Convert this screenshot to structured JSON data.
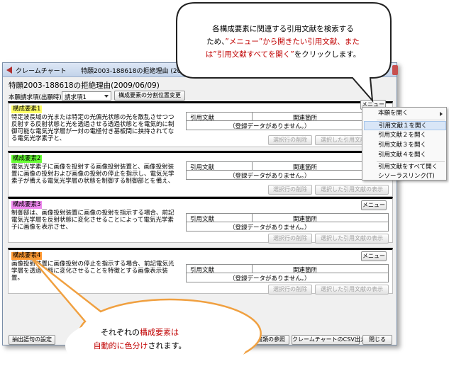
{
  "window": {
    "title_app": "クレームチャート",
    "title_doc": "特願2003-188618の拒絶理由 (2009/06/09)"
  },
  "heading": "特願2003-188618の拒絶理由(2009/06/09)",
  "claim_selector": {
    "label": "本願請求項(出願時):",
    "value": "請求項1",
    "split_button": "構成要素の分割位置変更"
  },
  "table_headers": {
    "citation": "引用文献",
    "location": "関連箇所"
  },
  "empty_message": "（登録データがありません。）",
  "panel_buttons": {
    "menu": "メニュー",
    "delete_selected": "選択行の削除",
    "show_selected": "選択した引用文献の表示"
  },
  "elements": [
    {
      "label": "構成要素1",
      "color": "#ffff66",
      "text": "特定波長域の光または特定の光偏光状態の光を散乱させつつ反射する反射状態と光を透過させる透過状態とを電気的に制御可能な電気光学層が一対の電極付き基板間に挟持されてなる電気光学素子と、"
    },
    {
      "label": "構成要素2",
      "color": "#66ff33",
      "text": "電気光学素子に画像を投射する画像投射装置と、画像投射装置に画像の投射および画像の投射の停止を指示し、電気光学素子が備える電気光学層の状態を制御する制御部とを備え、"
    },
    {
      "label": "構成要素3",
      "color": "#ee88ee",
      "text": "制御部は、画像投射装置に画像の投射を指示する場合、前記電気光学層を反射状態に変化させることによって電気光学素子に画像を表示させ、"
    },
    {
      "label": "構成要素4",
      "color": "#ff9933",
      "text": "画像投射装置に画像投射の停止を指示する場合、前記電気光学層を透過状態に変化させることを特徴とする画像表示装置。"
    }
  ],
  "context_menu": {
    "items": [
      {
        "label": "本願を開く",
        "submenu": true,
        "highlighted": false
      },
      {
        "label": "引用文献１を開く",
        "submenu": false,
        "highlighted": true
      },
      {
        "label": "引用文献２を開く",
        "submenu": false,
        "highlighted": false
      },
      {
        "label": "引用文献３を開く",
        "submenu": false,
        "highlighted": false
      },
      {
        "label": "引用文献４を開く",
        "submenu": false,
        "highlighted": false
      },
      {
        "label": "引用文献をすべて開く",
        "submenu": false,
        "highlighted": false
      },
      {
        "label": "シソーラスリンク(T)",
        "submenu": false,
        "highlighted": false
      }
    ]
  },
  "bottom_buttons": {
    "extract": "抽出語句の設定",
    "reference": "書類の参照",
    "csv": "クレームチャートのCSV出力",
    "close": "閉じる"
  },
  "callout_top": {
    "line1": "各構成要素に関連する引用文献を検索する",
    "line2_a": "ため、",
    "line2_b": "”メニュー”から開きたい引用文献、また",
    "line3_a": "は”引用文献すべてを開く”",
    "line3_b": "をクリックします。"
  },
  "callout_bottom": {
    "line1_a": "それぞれの",
    "line1_b": "構成要素は",
    "line2_a": "自動的に色分け",
    "line2_b": "されます。"
  }
}
